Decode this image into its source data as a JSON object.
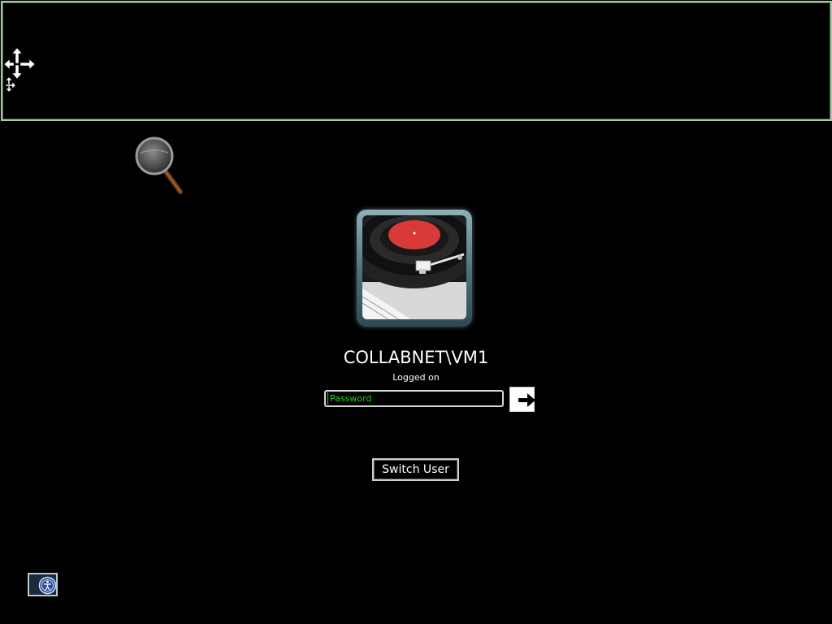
{
  "login": {
    "username": "COLLABNET\\VM1",
    "status": "Logged on",
    "password_placeholder": "Password",
    "submit_label": "",
    "switch_user_label": "Switch User"
  },
  "icons": {
    "move": "move-arrows-icon",
    "magnifier": "magnifying-glass-icon",
    "avatar": "turntable-record-picture",
    "submit": "arrow-right-icon",
    "ease_of_access": "ease-of-access-icon"
  },
  "colors": {
    "background": "#000000",
    "panel_border": "#a9c9a9",
    "password_text": "#22d41a",
    "text": "#ffffff"
  }
}
